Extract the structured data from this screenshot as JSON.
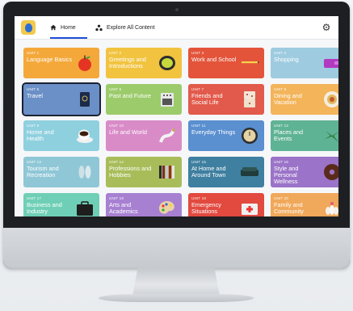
{
  "nav": {
    "home_label": "Home",
    "explore_label": "Explore All Content",
    "settings_icon": "gear-icon"
  },
  "units": [
    {
      "num": "UNIT 1",
      "title": "Language Basics",
      "color": "#f4a83a",
      "icon": "apple-icon"
    },
    {
      "num": "UNIT 2",
      "title": "Greetings and Introductions",
      "color": "#f1c33f",
      "icon": "sticker-icon"
    },
    {
      "num": "UNIT 3",
      "title": "Work and School",
      "color": "#e3543a",
      "icon": "pencil-icon"
    },
    {
      "num": "UNIT 4",
      "title": "Shopping",
      "color": "#9ecbe0",
      "icon": "wallet-icon"
    },
    {
      "num": "UNIT 5",
      "title": "Travel",
      "color": "#6b8fc7",
      "icon": "passport-icon",
      "selected": true
    },
    {
      "num": "UNIT 6",
      "title": "Past and Future",
      "color": "#9ccb6b",
      "icon": "stove-icon"
    },
    {
      "num": "UNIT 7",
      "title": "Friends and Social Life",
      "color": "#e25a4b",
      "icon": "dice-icon"
    },
    {
      "num": "UNIT 8",
      "title": "Dining and Vacation",
      "color": "#f3b45a",
      "icon": "plate-icon"
    },
    {
      "num": "UNIT 9",
      "title": "Home and Health",
      "color": "#8fd0df",
      "icon": "cup-icon"
    },
    {
      "num": "UNIT 10",
      "title": "Life and World",
      "color": "#d98bc8",
      "icon": "ribbon-icon"
    },
    {
      "num": "UNIT 11",
      "title": "Everyday Things",
      "color": "#5a8fd0",
      "icon": "clock-icon"
    },
    {
      "num": "UNIT 12",
      "title": "Places and Events",
      "color": "#5fb395",
      "icon": "plant-icon"
    },
    {
      "num": "UNIT 13",
      "title": "Tourism and Recreation",
      "color": "#8fc7d6",
      "icon": "flipflops-icon"
    },
    {
      "num": "UNIT 14",
      "title": "Professions and Hobbies",
      "color": "#a8bd5a",
      "icon": "books-icon"
    },
    {
      "num": "UNIT 15",
      "title": "At Home and Around Town",
      "color": "#3f7fa0",
      "icon": "sofa-icon"
    },
    {
      "num": "UNIT 16",
      "title": "Style and Personal Wellness",
      "color": "#9b73c8",
      "icon": "donut-icon"
    },
    {
      "num": "UNIT 17",
      "title": "Business and Industry",
      "color": "#6fcfb6",
      "icon": "briefcase-icon"
    },
    {
      "num": "UNIT 18",
      "title": "Arts and Academics",
      "color": "#a780d2",
      "icon": "palette-icon"
    },
    {
      "num": "UNIT 19",
      "title": "Emergency Situations",
      "color": "#e2493f",
      "icon": "firstaid-icon"
    },
    {
      "num": "UNIT 20",
      "title": "Family and Community",
      "color": "#f0a85a",
      "icon": "vases-icon"
    }
  ]
}
